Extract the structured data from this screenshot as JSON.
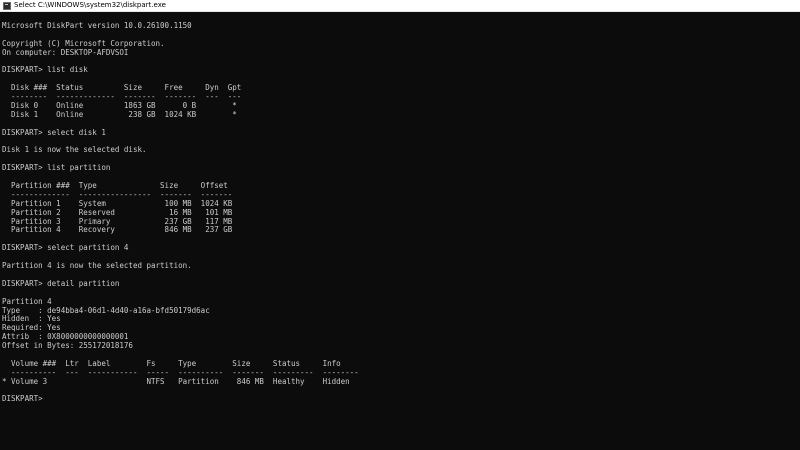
{
  "window": {
    "title": "Select C:\\WINDOWS\\system32\\diskpart.exe"
  },
  "console": {
    "lines": [
      "Microsoft DiskPart version 10.0.26100.1150",
      "",
      "Copyright (C) Microsoft Corporation.",
      "On computer: DESKTOP-AFDVSOI",
      "",
      "DISKPART> list disk",
      "",
      "  Disk ###  Status         Size     Free     Dyn  Gpt",
      "  --------  -------------  -------  -------  ---  ---",
      "  Disk 0    Online         1863 GB      0 B        *",
      "  Disk 1    Online          238 GB  1024 KB        *",
      "",
      "DISKPART> select disk 1",
      "",
      "Disk 1 is now the selected disk.",
      "",
      "DISKPART> list partition",
      "",
      "  Partition ###  Type              Size     Offset",
      "  -------------  ----------------  -------  -------",
      "  Partition 1    System             100 MB  1024 KB",
      "  Partition 2    Reserved            16 MB   101 MB",
      "  Partition 3    Primary            237 GB   117 MB",
      "  Partition 4    Recovery           846 MB   237 GB",
      "",
      "DISKPART> select partition 4",
      "",
      "Partition 4 is now the selected partition.",
      "",
      "DISKPART> detail partition",
      "",
      "Partition 4",
      "Type    : de94bba4-06d1-4d40-a16a-bfd50179d6ac",
      "Hidden  : Yes",
      "Required: Yes",
      "Attrib  : 0X8000000000000001",
      "Offset in Bytes: 255172018176",
      "",
      "  Volume ###  Ltr  Label        Fs     Type        Size     Status     Info",
      "  ----------  ---  -----------  -----  ----------  -------  ---------  --------",
      "* Volume 3                      NTFS   Partition    846 MB  Healthy    Hidden",
      "",
      "DISKPART> "
    ]
  }
}
